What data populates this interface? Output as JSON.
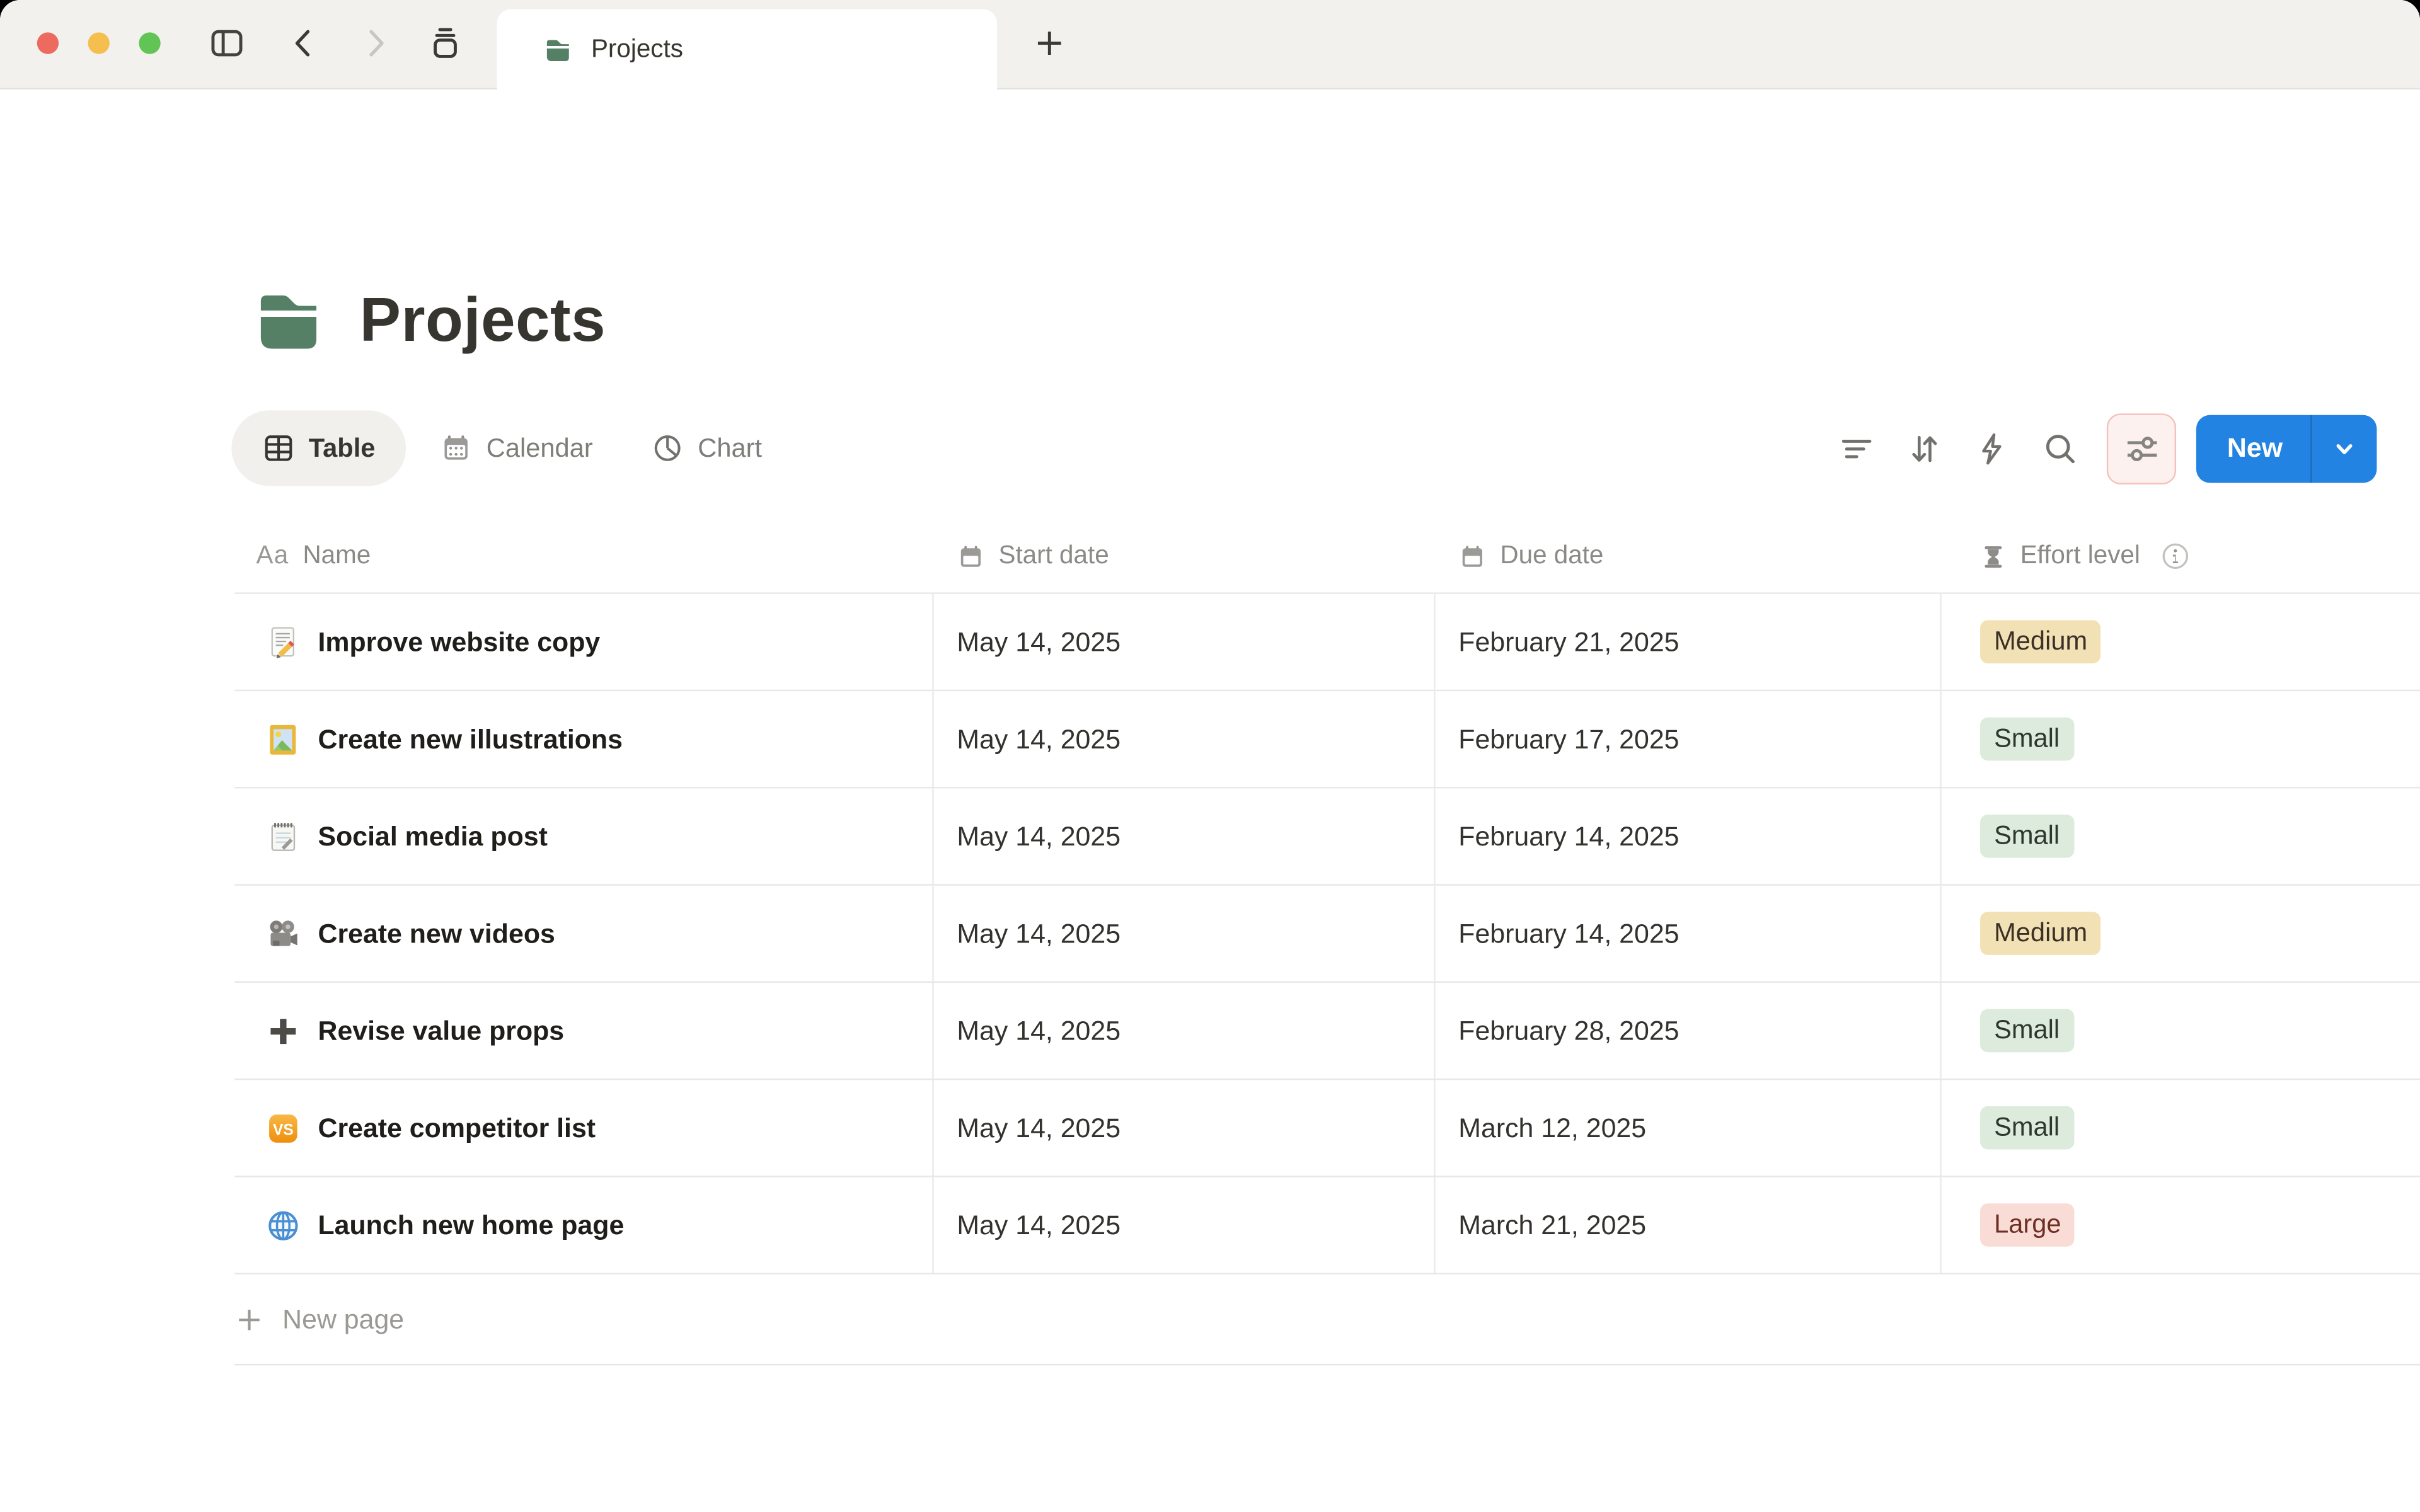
{
  "window": {
    "tab_title": "Projects",
    "traffic_colors": {
      "close": "#ec6a5e",
      "minimize": "#f4bf4f",
      "zoom": "#61c454"
    }
  },
  "page": {
    "title": "Projects",
    "icon": "green-folder"
  },
  "view_tabs": [
    {
      "label": "Table",
      "icon": "table-icon",
      "active": true
    },
    {
      "label": "Calendar",
      "icon": "calendar-icon",
      "active": false
    },
    {
      "label": "Chart",
      "icon": "pie-chart-icon",
      "active": false
    }
  ],
  "toolbar": {
    "icons": [
      "filter-icon",
      "sort-icon",
      "lightning-icon",
      "search-icon",
      "sliders-icon"
    ],
    "sliders_highlight_border": "#f3c2bb",
    "new_label": "New",
    "new_button_color": "#2383e2"
  },
  "table": {
    "columns": [
      {
        "label": "Name",
        "icon": "text-aa-icon"
      },
      {
        "label": "Start date",
        "icon": "calendar-icon"
      },
      {
        "label": "Due date",
        "icon": "calendar-icon"
      },
      {
        "label": "Effort level",
        "icon": "hourglass-icon",
        "info": true
      }
    ],
    "rows": [
      {
        "icon": "memo-emoji",
        "name": "Improve website copy",
        "start": "May 14, 2025",
        "due": "February 21, 2025",
        "effort": "Medium",
        "effort_color": "yellow"
      },
      {
        "icon": "framed-picture-emoji",
        "name": "Create new illustrations",
        "start": "May 14, 2025",
        "due": "February 17, 2025",
        "effort": "Small",
        "effort_color": "green"
      },
      {
        "icon": "spiral-notepad-emoji",
        "name": "Social media post",
        "start": "May 14, 2025",
        "due": "February 14, 2025",
        "effort": "Small",
        "effort_color": "green"
      },
      {
        "icon": "movie-camera-emoji",
        "name": "Create new videos",
        "start": "May 14, 2025",
        "due": "February 14, 2025",
        "effort": "Medium",
        "effort_color": "yellow"
      },
      {
        "icon": "heavy-plus-emoji",
        "name": "Revise value props",
        "start": "May 14, 2025",
        "due": "February 28, 2025",
        "effort": "Small",
        "effort_color": "green"
      },
      {
        "icon": "vs-emoji",
        "name": "Create competitor list",
        "start": "May 14, 2025",
        "due": "March 12, 2025",
        "effort": "Small",
        "effort_color": "green"
      },
      {
        "icon": "globe-emoji",
        "name": "Launch new home page",
        "start": "May 14, 2025",
        "due": "March 21, 2025",
        "effort": "Large",
        "effort_color": "red"
      }
    ],
    "new_page_label": "New page"
  },
  "badge_colors": {
    "yellow": {
      "bg": "#f3e1b6",
      "text": "#3a3025"
    },
    "green": {
      "bg": "#dcebdb",
      "text": "#2d372e"
    },
    "red": {
      "bg": "#fadcd6",
      "text": "#6d2f25"
    }
  }
}
